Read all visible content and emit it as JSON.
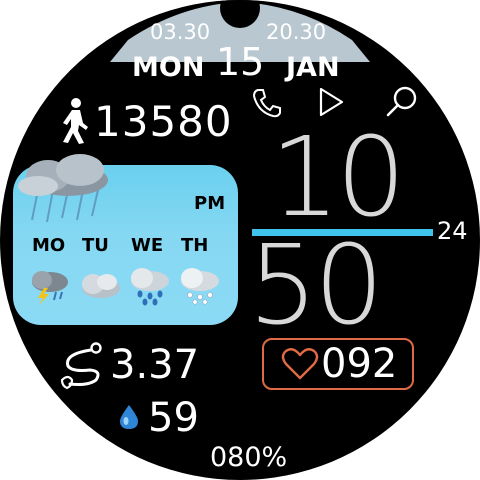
{
  "sun": {
    "sunrise": "03.30",
    "sunset": "20.30"
  },
  "date": {
    "weekday": "MON",
    "day": "15",
    "month": "JAN"
  },
  "shortcuts": [
    "phone-icon",
    "play-icon",
    "search-icon"
  ],
  "steps": "13580",
  "weather": {
    "ampm": "PM",
    "days": [
      "MO",
      "TU",
      "WE",
      "TH"
    ],
    "day_icons": [
      "thunderstorm-icon",
      "cloudy-icon",
      "rain-icon",
      "snow-icon"
    ]
  },
  "time": {
    "hours": "10",
    "minutes": "50",
    "format": "24"
  },
  "heart_rate": "092",
  "distance": "3.37",
  "humidity": "59",
  "battery": "080%",
  "colors": {
    "accent": "#3fc3ea",
    "heart": "#e06a45",
    "bezel": "#c9d6de"
  }
}
